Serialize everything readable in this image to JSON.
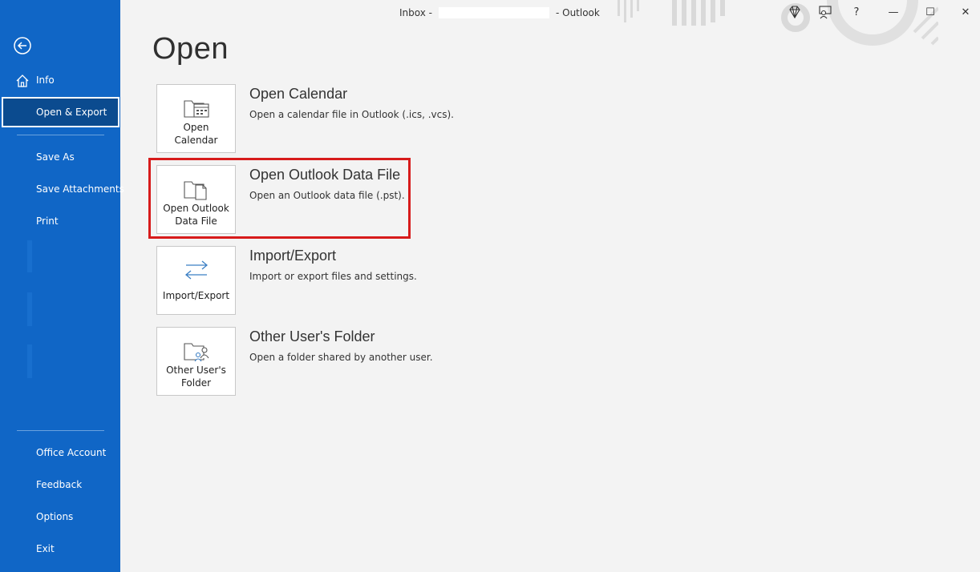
{
  "window": {
    "title_prefix": "Inbox -",
    "title_suffix": "-  Outlook",
    "buttons": {
      "diamond": "diamond-icon",
      "coauthor": "people-icon",
      "help": "?",
      "minimize": "—",
      "restore": "☐",
      "close": "✕"
    }
  },
  "sidebar": {
    "back_icon": "back-arrow-icon",
    "items_top": [
      {
        "label": "Info",
        "icon": "home-icon"
      },
      {
        "label": "Open & Export",
        "selected": true
      },
      {
        "label": "Save As"
      },
      {
        "label": "Save Attachments"
      },
      {
        "label": "Print"
      }
    ],
    "items_bottom": [
      {
        "label": "Office Account"
      },
      {
        "label": "Feedback"
      },
      {
        "label": "Options"
      },
      {
        "label": "Exit"
      }
    ]
  },
  "main": {
    "title": "Open",
    "options": [
      {
        "tile_label": "Open\nCalendar",
        "tile_line1": "Open",
        "tile_line2": "Calendar",
        "title": "Open Calendar",
        "description": "Open a calendar file in Outlook (.ics, .vcs).",
        "icon": "calendar-folder-icon"
      },
      {
        "tile_line1": "Open Outlook",
        "tile_line2": "Data File",
        "title": "Open Outlook Data File",
        "description": "Open an Outlook data file (.pst).",
        "icon": "data-file-folder-icon",
        "highlighted": true
      },
      {
        "tile_line1": "Import/Export",
        "tile_line2": "",
        "title": "Import/Export",
        "description": "Import or export files and settings.",
        "icon": "import-export-arrows-icon"
      },
      {
        "tile_line1": "Other User's",
        "tile_line2": "Folder",
        "title": "Other User's Folder",
        "description": "Open a folder shared by another user.",
        "icon": "shared-folder-icon"
      }
    ]
  },
  "colors": {
    "sidebar": "#1066c6",
    "sidebar_selected": "#0b4b8f",
    "background": "#f3f3f3",
    "highlight": "#d71b1b"
  }
}
